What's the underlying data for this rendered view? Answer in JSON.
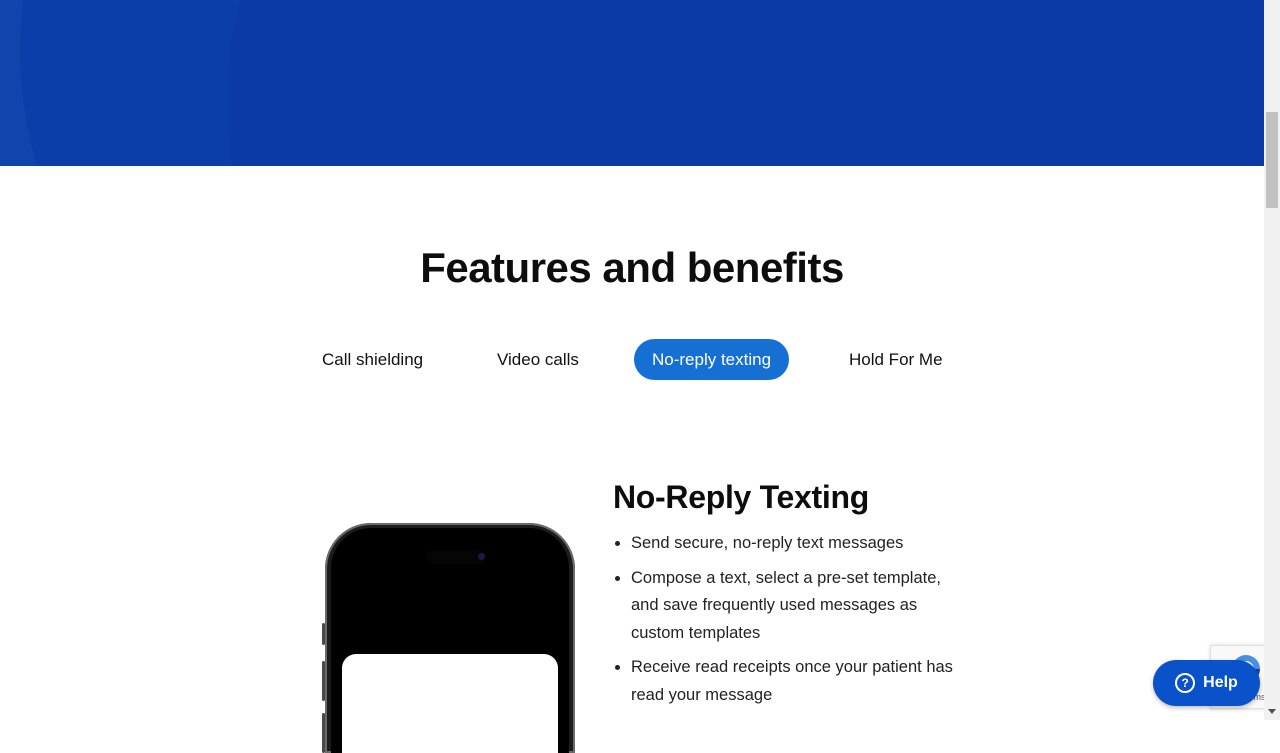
{
  "hero": {
    "accent": "#0b3aa6"
  },
  "section": {
    "title": "Features and benefits"
  },
  "tabs": [
    {
      "label": "Call shielding",
      "active": false
    },
    {
      "label": "Video calls",
      "active": false
    },
    {
      "label": "No-reply texting",
      "active": true
    },
    {
      "label": "Hold For Me",
      "active": false
    }
  ],
  "feature": {
    "title": "No-Reply Texting",
    "bullets": [
      "Send secure, no-reply text messages",
      "Compose a text, select a pre-set template, and save frequently used messages as custom templates",
      "Receive read receipts once your patient has read your message"
    ]
  },
  "recaptcha": {
    "terms_text": "Terms",
    "icon": "recaptcha-icon"
  },
  "help": {
    "label": "Help",
    "icon": "question-circle-icon"
  },
  "colors": {
    "tab_active": "#1670d4",
    "help_button": "#0a52c9"
  }
}
